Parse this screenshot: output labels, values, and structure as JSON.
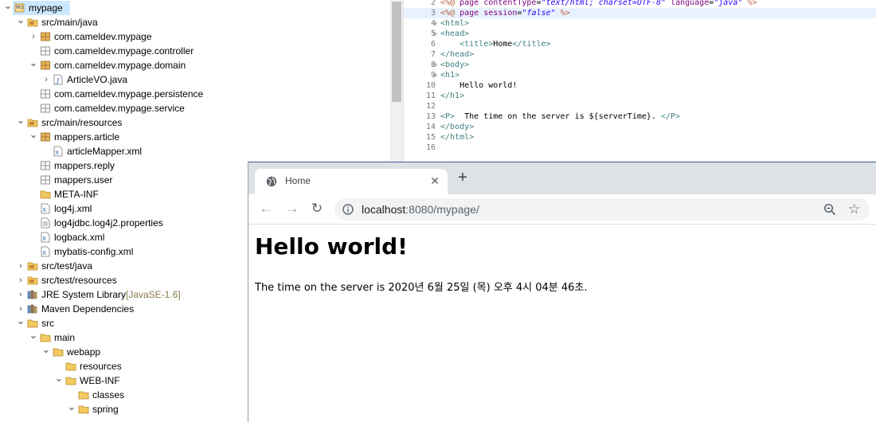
{
  "tree": {
    "items": [
      {
        "label": "mypage",
        "decoration": "",
        "icon": "maven-project-icon",
        "indent": 0,
        "expanded": true,
        "selected": true
      },
      {
        "label": "src/main/java",
        "decoration": "",
        "icon": "source-folder-icon",
        "indent": 1,
        "expanded": true
      },
      {
        "label": "com.cameldev.mypage",
        "decoration": "",
        "icon": "package-icon",
        "indent": 2,
        "expanded": false
      },
      {
        "label": "com.cameldev.mypage.controller",
        "decoration": "",
        "icon": "empty-package-icon",
        "indent": 2
      },
      {
        "label": "com.cameldev.mypage.domain",
        "decoration": "",
        "icon": "package-icon",
        "indent": 2,
        "expanded": true
      },
      {
        "label": "ArticleVO.java",
        "decoration": "",
        "icon": "java-file-icon",
        "indent": 3,
        "expanded": false
      },
      {
        "label": "com.cameldev.mypage.persistence",
        "decoration": "",
        "icon": "empty-package-icon",
        "indent": 2
      },
      {
        "label": "com.cameldev.mypage.service",
        "decoration": "",
        "icon": "empty-package-icon",
        "indent": 2
      },
      {
        "label": "src/main/resources",
        "decoration": "",
        "icon": "source-folder-icon",
        "indent": 1,
        "expanded": true
      },
      {
        "label": "mappers.article",
        "decoration": "",
        "icon": "package-icon",
        "indent": 2,
        "expanded": true
      },
      {
        "label": "articleMapper.xml",
        "decoration": "",
        "icon": "xml-file-icon",
        "indent": 3
      },
      {
        "label": "mappers.reply",
        "decoration": "",
        "icon": "empty-package-icon",
        "indent": 2
      },
      {
        "label": "mappers.user",
        "decoration": "",
        "icon": "empty-package-icon",
        "indent": 2
      },
      {
        "label": "META-INF",
        "decoration": "",
        "icon": "folder-icon",
        "indent": 2
      },
      {
        "label": "log4j.xml",
        "decoration": "",
        "icon": "xml-file-icon",
        "indent": 2
      },
      {
        "label": "log4jdbc.log4j2.properties",
        "decoration": "",
        "icon": "file-icon",
        "indent": 2
      },
      {
        "label": "logback.xml",
        "decoration": "",
        "icon": "xml-file-icon",
        "indent": 2
      },
      {
        "label": "mybatis-config.xml",
        "decoration": "",
        "icon": "xml-file-icon",
        "indent": 2
      },
      {
        "label": "src/test/java",
        "decoration": "",
        "icon": "source-folder-icon",
        "indent": 1,
        "expanded": false
      },
      {
        "label": "src/test/resources",
        "decoration": "",
        "icon": "source-folder-icon",
        "indent": 1,
        "expanded": false
      },
      {
        "label": "JRE System Library",
        "decoration": " [JavaSE-1.6]",
        "icon": "library-icon",
        "indent": 1,
        "expanded": false
      },
      {
        "label": "Maven Dependencies",
        "decoration": "",
        "icon": "library-icon",
        "indent": 1,
        "expanded": false
      },
      {
        "label": "src",
        "decoration": "",
        "icon": "folder-icon",
        "indent": 1,
        "expanded": true
      },
      {
        "label": "main",
        "decoration": "",
        "icon": "folder-icon",
        "indent": 2,
        "expanded": true
      },
      {
        "label": "webapp",
        "decoration": "",
        "icon": "folder-icon",
        "indent": 3,
        "expanded": true
      },
      {
        "label": "resources",
        "decoration": "",
        "icon": "folder-icon",
        "indent": 4
      },
      {
        "label": "WEB-INF",
        "decoration": "",
        "icon": "folder-icon",
        "indent": 4,
        "expanded": true
      },
      {
        "label": "classes",
        "decoration": "",
        "icon": "folder-icon",
        "indent": 5
      },
      {
        "label": "spring",
        "decoration": "",
        "icon": "folder-icon",
        "indent": 5,
        "expanded": true
      }
    ]
  },
  "editor": {
    "lines": [
      {
        "n": "2",
        "fold": "",
        "html": "<span class='dir'>&lt;%@</span> <span class='atn'>page</span> <span class='atn'>contentType</span>=<span class='atv'>\"text/html; charset=UTF-8\"</span> <span class='atn'>language</span>=<span class='atv'>\"java\"</span> <span class='dir'>%&gt;</span>"
      },
      {
        "n": "3",
        "fold": "",
        "current": true,
        "html": "<span class='dir'>&lt;%@</span> <span class='atn'>page</span> <span class='atn'>session</span>=<span class='atv'>\"false\"</span> <span class='dir'>%&gt;</span>"
      },
      {
        "n": "4",
        "fold": "⊖",
        "html": "<span class='tag'>&lt;html&gt;</span>"
      },
      {
        "n": "5",
        "fold": "⊖",
        "html": "<span class='tag'>&lt;head&gt;</span>"
      },
      {
        "n": "6",
        "fold": "",
        "html": "    <span class='tag'>&lt;title&gt;</span><span class='txt'>Home</span><span class='tag'>&lt;/title&gt;</span>"
      },
      {
        "n": "7",
        "fold": "",
        "html": "<span class='tag'>&lt;/head&gt;</span>"
      },
      {
        "n": "8",
        "fold": "⊖",
        "html": "<span class='tag'>&lt;body&gt;</span>"
      },
      {
        "n": "9",
        "fold": "⊖",
        "html": "<span class='tag'>&lt;h1&gt;</span>"
      },
      {
        "n": "10",
        "fold": "",
        "html": "    <span class='txt'>Hello world!</span>"
      },
      {
        "n": "11",
        "fold": "",
        "html": "<span class='tag'>&lt;/h1&gt;</span>"
      },
      {
        "n": "12",
        "fold": "",
        "html": ""
      },
      {
        "n": "13",
        "fold": "",
        "html": "<span class='tag'>&lt;P&gt;</span>  <span class='txt'>The time on the server is ${serverTime}.</span> <span class='tag'>&lt;/P&gt;</span>"
      },
      {
        "n": "14",
        "fold": "",
        "html": "<span class='tag'>&lt;/body&gt;</span>"
      },
      {
        "n": "15",
        "fold": "",
        "html": "<span class='tag'>&lt;/html&gt;</span>"
      },
      {
        "n": "16",
        "fold": "",
        "html": ""
      }
    ]
  },
  "browser": {
    "tab_title": "Home",
    "tab_close": "✕",
    "new_tab": "+",
    "back": "←",
    "forward": "→",
    "reload": "↻",
    "url_host": "localhost",
    "url_rest": ":8080/mypage/",
    "star": "☆",
    "page": {
      "heading": "Hello world!",
      "paragraph": "The time on the server is 2020년 6월 25일 (목) 오후 4시 04분 46초."
    }
  },
  "colors": {
    "selection": "#cce8ff",
    "tabstrip": "#dee1e6",
    "omnibox": "#f1f3f4"
  }
}
